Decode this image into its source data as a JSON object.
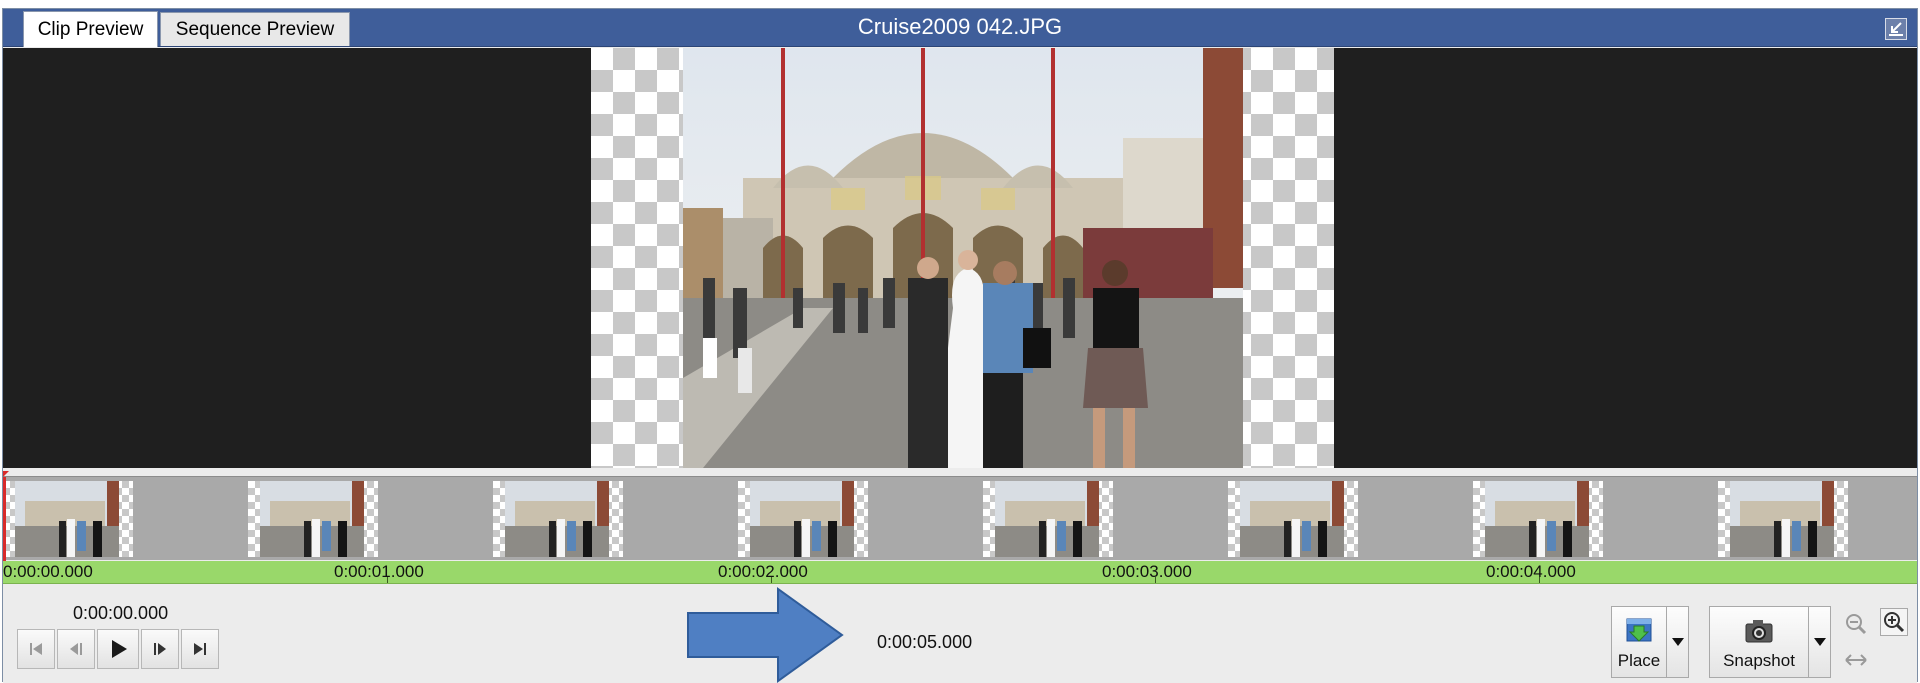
{
  "tabs": [
    {
      "label": "Clip Preview",
      "active": true
    },
    {
      "label": "Sequence Preview",
      "active": false
    }
  ],
  "window": {
    "title": "Cruise2009 042.JPG",
    "restore_icon": "restore-window-icon"
  },
  "preview": {
    "image_subject": "St. Mark's Basilica, Venice — bride and crowd in piazza",
    "transparency_pattern": "checkerboard"
  },
  "filmstrip": {
    "frame_count": 8,
    "playhead_color": "#d92a2a"
  },
  "ruler": {
    "labels": [
      "0:00:00.000",
      "0:00:01.000",
      "0:00:02.000",
      "0:00:03.000",
      "0:00:04.000"
    ],
    "color": "#99d86a"
  },
  "controls": {
    "current_time": "0:00:00.000",
    "duration": "0:00:05.000",
    "transport_icons": [
      "skip-to-start-icon",
      "step-back-icon",
      "play-icon",
      "step-forward-icon",
      "skip-to-end-icon"
    ],
    "place_label": "Place",
    "snapshot_label": "Snapshot",
    "zoom_icons": [
      "zoom-out-icon",
      "zoom-in-icon",
      "fit-width-icon"
    ]
  },
  "annotation": {
    "arrow_color": "#4f7fc3"
  }
}
